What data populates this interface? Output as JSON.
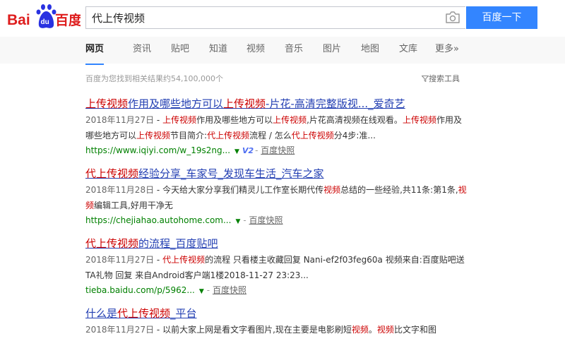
{
  "logo": {
    "text": "百度",
    "bai": "Bai",
    "du": "du"
  },
  "search": {
    "query": "代上传视频",
    "button_label": "百度一下"
  },
  "tabs": [
    {
      "label": "网页",
      "active": true
    },
    {
      "label": "资讯"
    },
    {
      "label": "贴吧"
    },
    {
      "label": "知道"
    },
    {
      "label": "视频"
    },
    {
      "label": "音乐"
    },
    {
      "label": "图片"
    },
    {
      "label": "地图"
    },
    {
      "label": "文库"
    },
    {
      "label": "更多»"
    }
  ],
  "stats": "百度为您找到相关结果约54,100,000个",
  "tools_label": "搜索工具",
  "results": [
    {
      "title": "上传视频作用及哪些地方可以上传视频-片花-高清完整版视..._爱奇艺",
      "date": "2018年11月27日",
      "abstract": "上传视频作用及哪些地方可以上传视频,片花高清视频在线观看。上传视频作用及哪些地方可以上传视频节目简介:代上传视频流程 / 怎么代上传视频分4步:准...",
      "url": "https://www.iqiyi.com/w_19s2ng...",
      "v2": "V2",
      "cache": "百度快照"
    },
    {
      "title": "代上传视频经验分享_车家号_发现车生活_汽车之家",
      "date": "2018年11月28日",
      "abstract": "今天给大家分享我们精灵儿工作室长期代传视频总结的一些经验,共11条:第1条,视频编辑工具,好用干净无",
      "url": "https://chejiahao.autohome.com...",
      "cache": "百度快照"
    },
    {
      "title": "代上传视频的流程_百度贴吧",
      "date": "2018年11月27日",
      "abstract": "代上传视频的流程 只看楼主收藏回复 Nani-ef2f03feg60a 视频来自:百度贴吧送TA礼物 回复 来自Android客户端1楼2018-11-27 23:23...",
      "url": "tieba.baidu.com/p/5962...",
      "cache": "百度快照"
    },
    {
      "title": "什么是代上传视频_平台",
      "date": "2018年11月27日",
      "abstract": "以前大家上网是看文字看图片,现在主要是电影刷短视频。视频比文字和图"
    }
  ],
  "colors": {
    "brand_red": "#de1d1d",
    "brand_blue": "#2932e1",
    "button": "#3385ff",
    "link": "#2440b3",
    "url_green": "#008000"
  }
}
